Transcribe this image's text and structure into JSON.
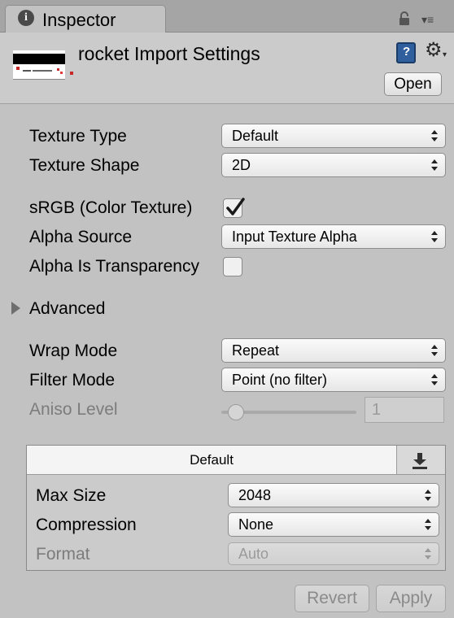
{
  "tab": {
    "label": "Inspector",
    "info_glyph": "i"
  },
  "header": {
    "title": "rocket Import Settings",
    "open_label": "Open"
  },
  "fields": {
    "texture_type": {
      "label": "Texture Type",
      "value": "Default"
    },
    "texture_shape": {
      "label": "Texture Shape",
      "value": "2D"
    },
    "srgb": {
      "label": "sRGB (Color Texture)",
      "checked": true
    },
    "alpha_source": {
      "label": "Alpha Source",
      "value": "Input Texture Alpha"
    },
    "alpha_transparency": {
      "label": "Alpha Is Transparency",
      "checked": false
    },
    "advanced": {
      "label": "Advanced"
    },
    "wrap_mode": {
      "label": "Wrap Mode",
      "value": "Repeat"
    },
    "filter_mode": {
      "label": "Filter Mode",
      "value": "Point (no filter)"
    },
    "aniso_level": {
      "label": "Aniso Level",
      "value": "1",
      "fraction": 0.0
    }
  },
  "platform": {
    "tab_label": "Default",
    "max_size": {
      "label": "Max Size",
      "value": "2048"
    },
    "compression": {
      "label": "Compression",
      "value": "None"
    },
    "format": {
      "label": "Format",
      "value": "Auto"
    }
  },
  "footer": {
    "revert_label": "Revert",
    "apply_label": "Apply"
  },
  "icons": [
    "info-icon",
    "lock-icon",
    "menu-icon",
    "help-book-icon",
    "gear-icon",
    "foldout-arrow-icon",
    "download-icon"
  ],
  "colors": {
    "background": "#c2c2c2",
    "checkmark": "#1a1a1a"
  }
}
